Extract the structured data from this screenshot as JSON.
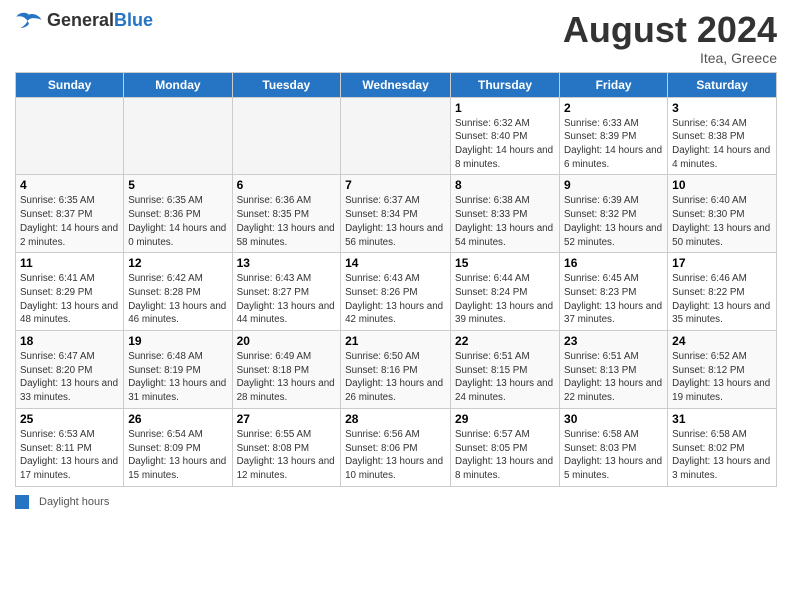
{
  "header": {
    "logo_general": "General",
    "logo_blue": "Blue",
    "month_year": "August 2024",
    "location": "Itea, Greece"
  },
  "footer": {
    "daylight_label": "Daylight hours"
  },
  "weekdays": [
    "Sunday",
    "Monday",
    "Tuesday",
    "Wednesday",
    "Thursday",
    "Friday",
    "Saturday"
  ],
  "weeks": [
    [
      {
        "num": "",
        "info": ""
      },
      {
        "num": "",
        "info": ""
      },
      {
        "num": "",
        "info": ""
      },
      {
        "num": "",
        "info": ""
      },
      {
        "num": "1",
        "info": "Sunrise: 6:32 AM\nSunset: 8:40 PM\nDaylight: 14 hours and 8 minutes."
      },
      {
        "num": "2",
        "info": "Sunrise: 6:33 AM\nSunset: 8:39 PM\nDaylight: 14 hours and 6 minutes."
      },
      {
        "num": "3",
        "info": "Sunrise: 6:34 AM\nSunset: 8:38 PM\nDaylight: 14 hours and 4 minutes."
      }
    ],
    [
      {
        "num": "4",
        "info": "Sunrise: 6:35 AM\nSunset: 8:37 PM\nDaylight: 14 hours and 2 minutes."
      },
      {
        "num": "5",
        "info": "Sunrise: 6:35 AM\nSunset: 8:36 PM\nDaylight: 14 hours and 0 minutes."
      },
      {
        "num": "6",
        "info": "Sunrise: 6:36 AM\nSunset: 8:35 PM\nDaylight: 13 hours and 58 minutes."
      },
      {
        "num": "7",
        "info": "Sunrise: 6:37 AM\nSunset: 8:34 PM\nDaylight: 13 hours and 56 minutes."
      },
      {
        "num": "8",
        "info": "Sunrise: 6:38 AM\nSunset: 8:33 PM\nDaylight: 13 hours and 54 minutes."
      },
      {
        "num": "9",
        "info": "Sunrise: 6:39 AM\nSunset: 8:32 PM\nDaylight: 13 hours and 52 minutes."
      },
      {
        "num": "10",
        "info": "Sunrise: 6:40 AM\nSunset: 8:30 PM\nDaylight: 13 hours and 50 minutes."
      }
    ],
    [
      {
        "num": "11",
        "info": "Sunrise: 6:41 AM\nSunset: 8:29 PM\nDaylight: 13 hours and 48 minutes."
      },
      {
        "num": "12",
        "info": "Sunrise: 6:42 AM\nSunset: 8:28 PM\nDaylight: 13 hours and 46 minutes."
      },
      {
        "num": "13",
        "info": "Sunrise: 6:43 AM\nSunset: 8:27 PM\nDaylight: 13 hours and 44 minutes."
      },
      {
        "num": "14",
        "info": "Sunrise: 6:43 AM\nSunset: 8:26 PM\nDaylight: 13 hours and 42 minutes."
      },
      {
        "num": "15",
        "info": "Sunrise: 6:44 AM\nSunset: 8:24 PM\nDaylight: 13 hours and 39 minutes."
      },
      {
        "num": "16",
        "info": "Sunrise: 6:45 AM\nSunset: 8:23 PM\nDaylight: 13 hours and 37 minutes."
      },
      {
        "num": "17",
        "info": "Sunrise: 6:46 AM\nSunset: 8:22 PM\nDaylight: 13 hours and 35 minutes."
      }
    ],
    [
      {
        "num": "18",
        "info": "Sunrise: 6:47 AM\nSunset: 8:20 PM\nDaylight: 13 hours and 33 minutes."
      },
      {
        "num": "19",
        "info": "Sunrise: 6:48 AM\nSunset: 8:19 PM\nDaylight: 13 hours and 31 minutes."
      },
      {
        "num": "20",
        "info": "Sunrise: 6:49 AM\nSunset: 8:18 PM\nDaylight: 13 hours and 28 minutes."
      },
      {
        "num": "21",
        "info": "Sunrise: 6:50 AM\nSunset: 8:16 PM\nDaylight: 13 hours and 26 minutes."
      },
      {
        "num": "22",
        "info": "Sunrise: 6:51 AM\nSunset: 8:15 PM\nDaylight: 13 hours and 24 minutes."
      },
      {
        "num": "23",
        "info": "Sunrise: 6:51 AM\nSunset: 8:13 PM\nDaylight: 13 hours and 22 minutes."
      },
      {
        "num": "24",
        "info": "Sunrise: 6:52 AM\nSunset: 8:12 PM\nDaylight: 13 hours and 19 minutes."
      }
    ],
    [
      {
        "num": "25",
        "info": "Sunrise: 6:53 AM\nSunset: 8:11 PM\nDaylight: 13 hours and 17 minutes."
      },
      {
        "num": "26",
        "info": "Sunrise: 6:54 AM\nSunset: 8:09 PM\nDaylight: 13 hours and 15 minutes."
      },
      {
        "num": "27",
        "info": "Sunrise: 6:55 AM\nSunset: 8:08 PM\nDaylight: 13 hours and 12 minutes."
      },
      {
        "num": "28",
        "info": "Sunrise: 6:56 AM\nSunset: 8:06 PM\nDaylight: 13 hours and 10 minutes."
      },
      {
        "num": "29",
        "info": "Sunrise: 6:57 AM\nSunset: 8:05 PM\nDaylight: 13 hours and 8 minutes."
      },
      {
        "num": "30",
        "info": "Sunrise: 6:58 AM\nSunset: 8:03 PM\nDaylight: 13 hours and 5 minutes."
      },
      {
        "num": "31",
        "info": "Sunrise: 6:58 AM\nSunset: 8:02 PM\nDaylight: 13 hours and 3 minutes."
      }
    ]
  ]
}
